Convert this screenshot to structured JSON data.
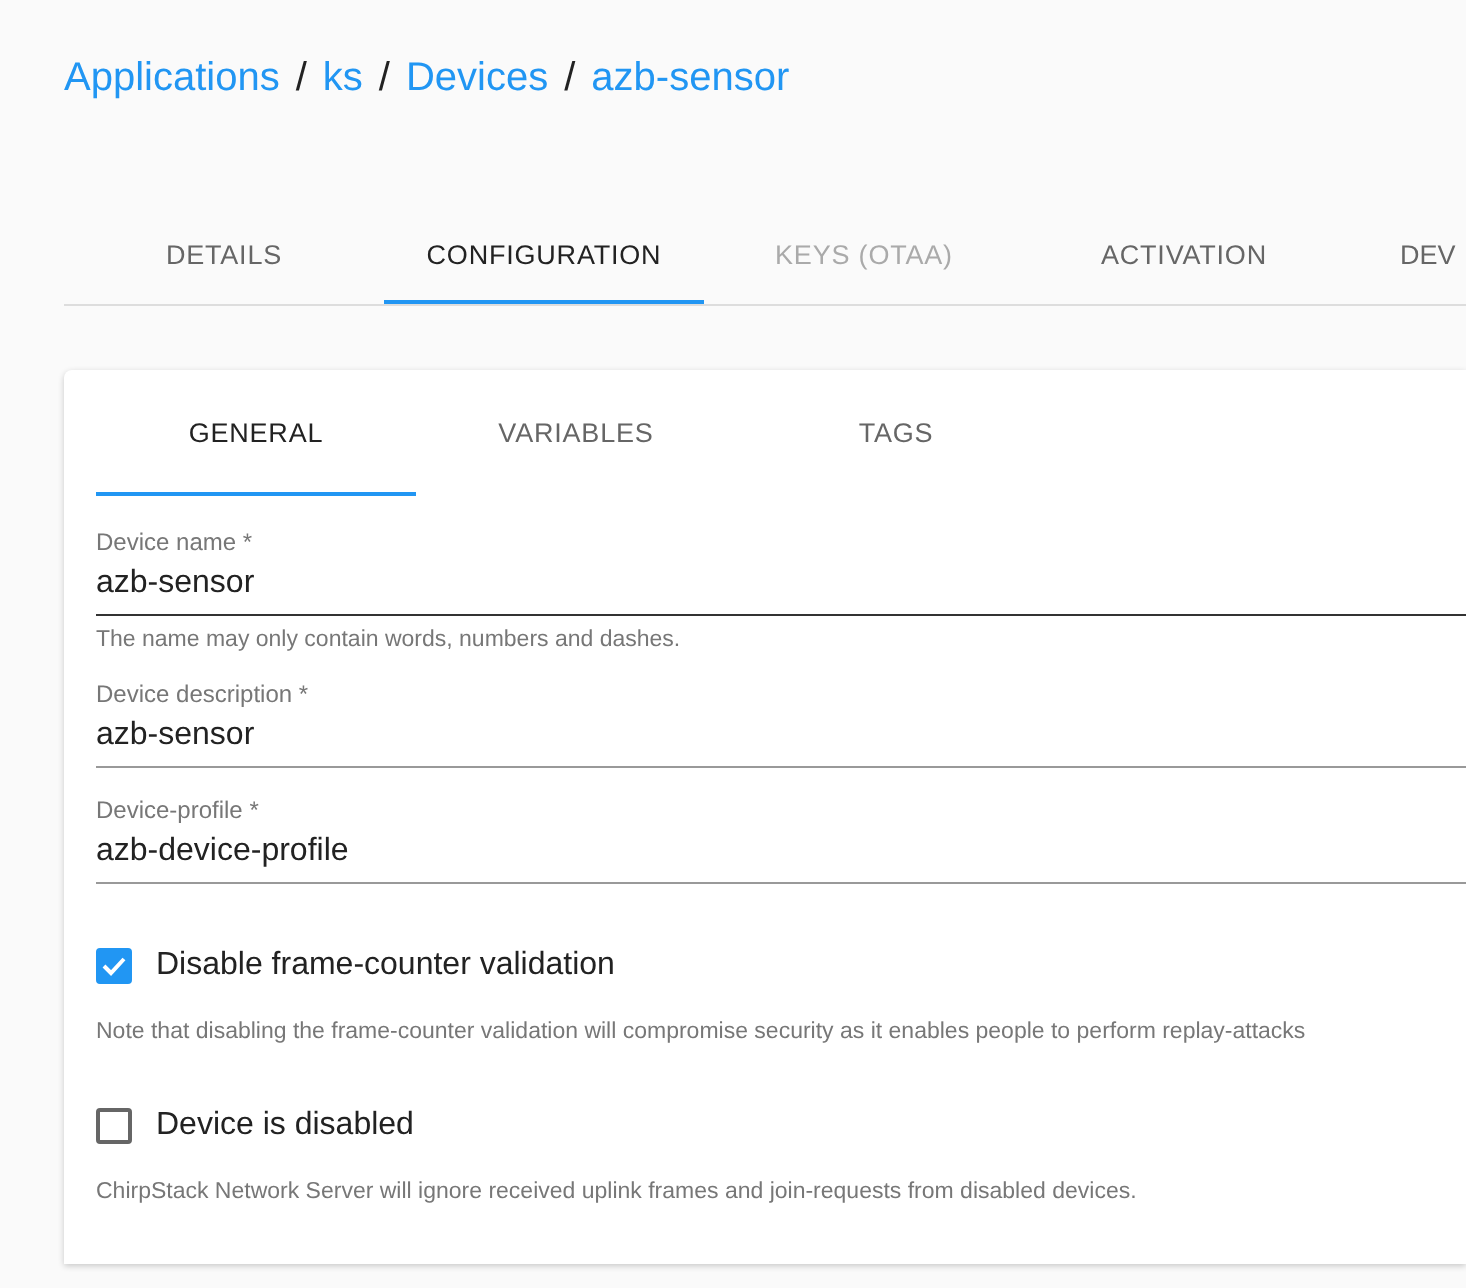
{
  "breadcrumb": [
    "Applications",
    "ks",
    "Devices",
    "azb-sensor"
  ],
  "breadcrumb_separator": "/",
  "tabs": [
    {
      "label": "DETAILS",
      "selected": false,
      "disabled": false
    },
    {
      "label": "CONFIGURATION",
      "selected": true,
      "disabled": false
    },
    {
      "label": "KEYS (OTAA)",
      "selected": false,
      "disabled": true
    },
    {
      "label": "ACTIVATION",
      "selected": false,
      "disabled": false
    },
    {
      "label": "DEV",
      "selected": false,
      "disabled": false
    }
  ],
  "subtabs": [
    {
      "label": "GENERAL",
      "selected": true
    },
    {
      "label": "VARIABLES",
      "selected": false
    },
    {
      "label": "TAGS",
      "selected": false
    }
  ],
  "fields": [
    {
      "label": "Device name *",
      "value": "azb-sensor",
      "helper": "The name may only contain words, numbers and dashes.",
      "focused": true
    },
    {
      "label": "Device description *",
      "value": "azb-sensor",
      "focused": false
    },
    {
      "label": "Device-profile *",
      "value": "azb-device-profile",
      "focused": false
    }
  ],
  "checkboxes": [
    {
      "label": "Disable frame-counter validation",
      "checked": true,
      "helper": "Note that disabling the frame-counter validation will compromise security as it enables people to perform replay-attacks"
    },
    {
      "label": "Device is disabled",
      "checked": false,
      "helper": "ChirpStack Network Server will ignore received uplink frames and join-requests from disabled devices."
    }
  ]
}
